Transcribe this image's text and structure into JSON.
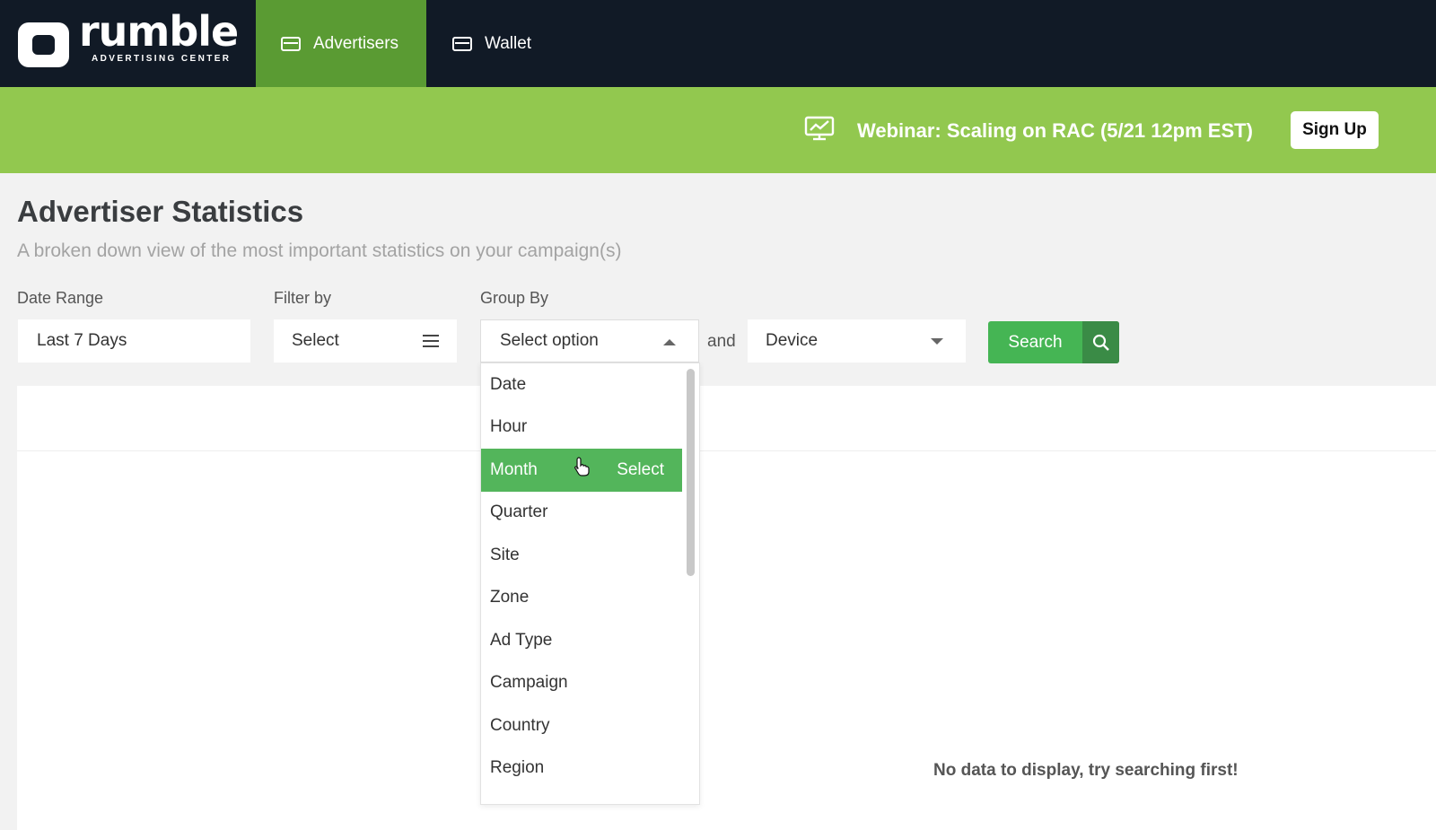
{
  "nav": {
    "logo_text": "rumble",
    "logo_subtext": "ADVERTISING CENTER",
    "tabs": [
      {
        "label": "Advertisers",
        "active": true
      },
      {
        "label": "Wallet",
        "active": false
      }
    ]
  },
  "banner": {
    "text": "Webinar: Scaling on RAC (5/21 12pm EST)",
    "signup_label": "Sign Up",
    "icon": "chart-presentation-icon"
  },
  "page": {
    "title": "Advertiser Statistics",
    "subtitle": "A broken down view of the most important statistics on your campaign(s)"
  },
  "filters": {
    "date_range_label": "Date Range",
    "date_range_value": "Last 7 Days",
    "filter_by_label": "Filter by",
    "filter_by_value": "Select",
    "group_by_label": "Group By",
    "group_by_value": "Select option",
    "and_text": "and",
    "device_value": "Device",
    "search_label": "Search"
  },
  "dropdown": {
    "items": [
      "Date",
      "Hour",
      "Month",
      "Quarter",
      "Site",
      "Zone",
      "Ad Type",
      "Campaign",
      "Country",
      "Region"
    ],
    "highlighted_index": 2,
    "select_hint": "Select"
  },
  "results": {
    "empty_text": "No data to display, try searching first!"
  },
  "colors": {
    "nav_bg": "#111a26",
    "active_tab": "#5a9b33",
    "banner": "#92c84f",
    "search_button": "#45b554",
    "highlight": "#53b55b"
  }
}
